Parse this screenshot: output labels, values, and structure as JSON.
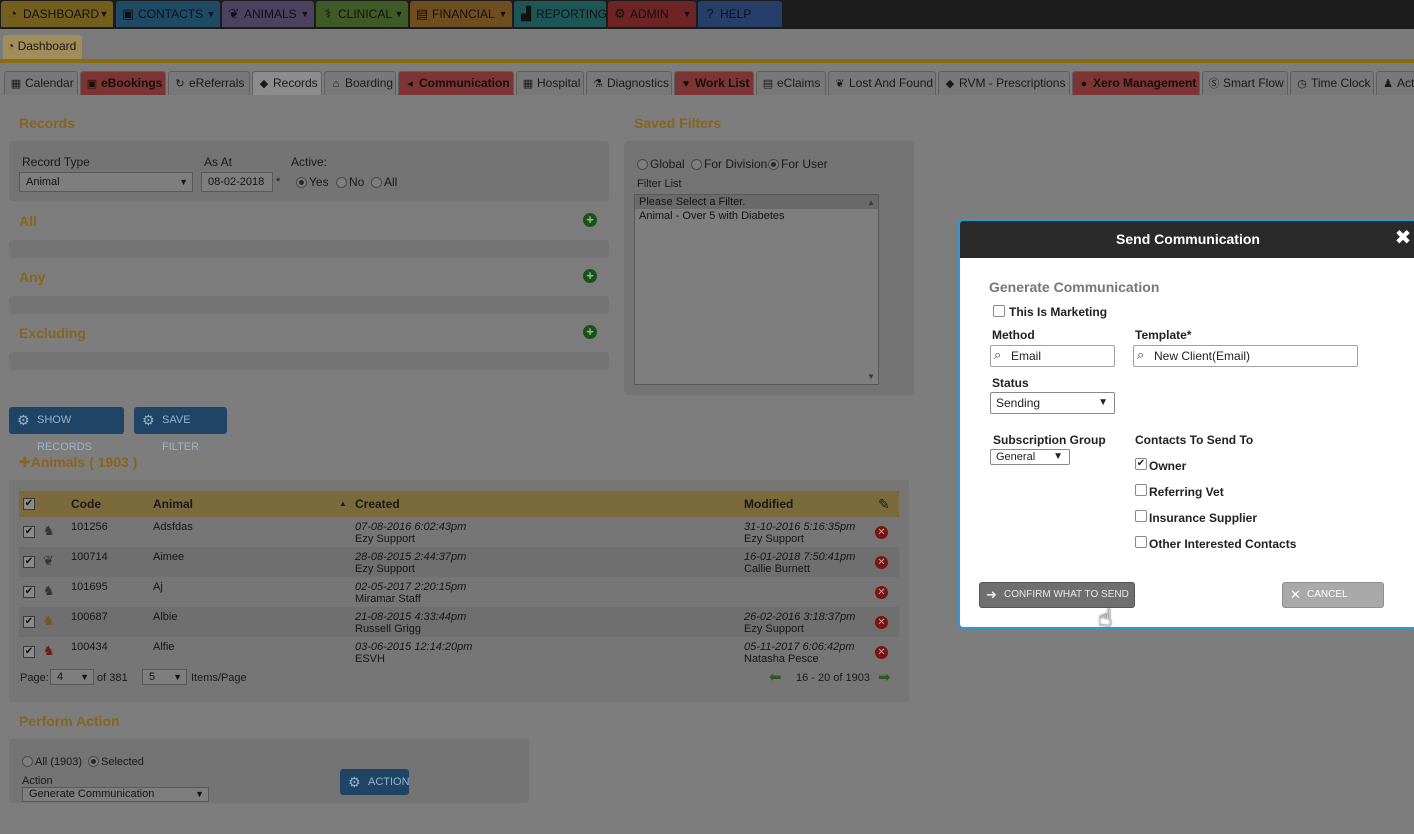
{
  "topnav": {
    "items": [
      {
        "label": "DASHBOARD",
        "icon": "gauge-icon",
        "color": "#e2b83c"
      },
      {
        "label": "CONTACTS",
        "icon": "contacts-icon",
        "color": "#3a8ac0"
      },
      {
        "label": "ANIMALS",
        "icon": "paw-icon",
        "color": "#8878a8"
      },
      {
        "label": "CLINICAL",
        "icon": "caduceus-icon",
        "color": "#7aa846"
      },
      {
        "label": "FINANCIAL",
        "icon": "money-icon",
        "color": "#d89a38"
      },
      {
        "label": "REPORTING",
        "icon": "chart-icon",
        "color": "#3aa4a4"
      },
      {
        "label": "ADMIN",
        "icon": "gear-icon",
        "color": "#d84848"
      },
      {
        "label": "HELP",
        "icon": "help-icon",
        "color": "#4a78c8"
      }
    ]
  },
  "subtab": {
    "label": "Dashboard"
  },
  "tabs": [
    {
      "label": "Calendar",
      "icon": "calendar-icon"
    },
    {
      "label": "eBookings",
      "icon": "ebooking-icon"
    },
    {
      "label": "eReferrals",
      "icon": "refresh-icon"
    },
    {
      "label": "Records",
      "icon": "tag-icon"
    },
    {
      "label": "Boarding",
      "icon": "house-icon"
    },
    {
      "label": "Communication",
      "icon": "megaphone-icon"
    },
    {
      "label": "Hospital",
      "icon": "hospital-icon"
    },
    {
      "label": "Diagnostics",
      "icon": "flask-icon"
    },
    {
      "label": "Work List",
      "icon": "heart-icon"
    },
    {
      "label": "eClaims",
      "icon": "claim-icon"
    },
    {
      "label": "Lost And Found",
      "icon": "paw-search-icon"
    },
    {
      "label": "RVM - Prescriptions",
      "icon": "diamond-icon"
    },
    {
      "label": "Xero Management",
      "icon": "xero-icon"
    },
    {
      "label": "Smart Flow",
      "icon": "smartflow-icon"
    },
    {
      "label": "Time Clock",
      "icon": "clock-icon"
    },
    {
      "label": "Acti",
      "icon": "person-icon"
    }
  ],
  "records": {
    "title": "Records",
    "record_type_label": "Record Type",
    "record_type_value": "Animal",
    "as_at_label": "As At",
    "as_at_value": "08-02-2018",
    "required_mark": "*",
    "active_label": "Active:",
    "active_options": [
      "Yes",
      "No",
      "All"
    ],
    "all_label": "All",
    "any_label": "Any",
    "excluding_label": "Excluding"
  },
  "saved_filters": {
    "title": "Saved Filters",
    "scope_options": [
      "Global",
      "For Division",
      "For User"
    ],
    "filter_list_label": "Filter List",
    "options": [
      "Please Select a Filter.",
      "Animal - Over 5 with Diabetes"
    ]
  },
  "buttons": {
    "show_records": "SHOW RECORDS",
    "save_filter": "SAVE FILTER",
    "action": "ACTION"
  },
  "animals_header": "Animals ( 1903 )",
  "table": {
    "headers": [
      "Code",
      "Animal",
      "Created",
      "Modified"
    ],
    "rows": [
      {
        "code": "101256",
        "animal": "Adsfdas",
        "created": "07-08-2016 6:02:43pm",
        "created_by": "Ezy Support",
        "modified": "31-10-2016 5:16:35pm",
        "modified_by": "Ezy Support",
        "icon": "dog-icon"
      },
      {
        "code": "100714",
        "animal": "Aimee",
        "created": "28-08-2015 2:44:37pm",
        "created_by": "Ezy Support",
        "modified": "16-01-2018 7:50:41pm",
        "modified_by": "Callie Burnett",
        "icon": "paw-icon"
      },
      {
        "code": "101695",
        "animal": "Aj",
        "created": "02-05-2017 2:20:15pm",
        "created_by": "Miramar Staff",
        "modified": "",
        "modified_by": "",
        "icon": "dog-icon"
      },
      {
        "code": "100687",
        "animal": "Albie",
        "created": "21-08-2015 4:33:44pm",
        "created_by": "Russell Grigg",
        "modified": "26-02-2016 3:18:37pm",
        "modified_by": "Ezy Support",
        "icon": "dog-warning-icon"
      },
      {
        "code": "100434",
        "animal": "Alfie",
        "created": "03-06-2015 12:14:20pm",
        "created_by": "ESVH",
        "modified": "05-11-2017 6:06:42pm",
        "modified_by": "Natasha Pesce",
        "icon": "dog-red-icon"
      }
    ],
    "pager": {
      "page_label": "Page:",
      "page_value": "4",
      "of_label": "of 381",
      "per_page_value": "5",
      "per_page_label": "Items/Page",
      "range": "16 - 20 of 1903"
    }
  },
  "perform_action": {
    "title": "Perform Action",
    "scope_options": [
      "All (1903)",
      "Selected"
    ],
    "action_label": "Action",
    "action_value": "Generate Communication"
  },
  "modal": {
    "title": "Send Communication",
    "section_title": "Generate Communication",
    "marketing_label": "This Is Marketing",
    "method_label": "Method",
    "method_value": "Email",
    "template_label": "Template*",
    "template_value": "New Client(Email)",
    "status_label": "Status",
    "status_value": "Sending",
    "subscription_label": "Subscription Group",
    "subscription_value": "General",
    "contacts_label": "Contacts To Send To",
    "contacts": [
      {
        "label": "Owner",
        "checked": true
      },
      {
        "label": "Referring Vet",
        "checked": false
      },
      {
        "label": "Insurance Supplier",
        "checked": false
      },
      {
        "label": "Other Interested Contacts",
        "checked": false
      }
    ],
    "confirm_label": "CONFIRM WHAT TO SEND",
    "cancel_label": "CANCEL"
  }
}
